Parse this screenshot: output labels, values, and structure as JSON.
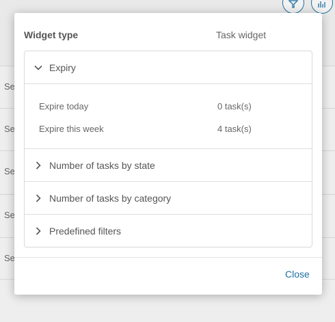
{
  "background": {
    "rows": [
      "Se",
      "Se",
      "Se",
      "Se",
      "Se"
    ],
    "toolbar": [
      {
        "icon": "filter-icon"
      },
      {
        "icon": "bar-chart-icon"
      }
    ]
  },
  "dialog": {
    "header": {
      "label": "Widget type",
      "value": "Task widget"
    },
    "sections": [
      {
        "title": "Expiry",
        "expanded": true,
        "rows": [
          {
            "label": "Expire today",
            "value": "0 task(s)"
          },
          {
            "label": "Expire this week",
            "value": "4 task(s)"
          }
        ]
      },
      {
        "title": "Number of tasks by state",
        "expanded": false
      },
      {
        "title": "Number of tasks by category",
        "expanded": false
      },
      {
        "title": "Predefined filters",
        "expanded": false
      }
    ],
    "close_label": "Close"
  },
  "colors": {
    "accent": "#1d6fa3",
    "text": "#555555",
    "border": "#d9d9d9"
  }
}
